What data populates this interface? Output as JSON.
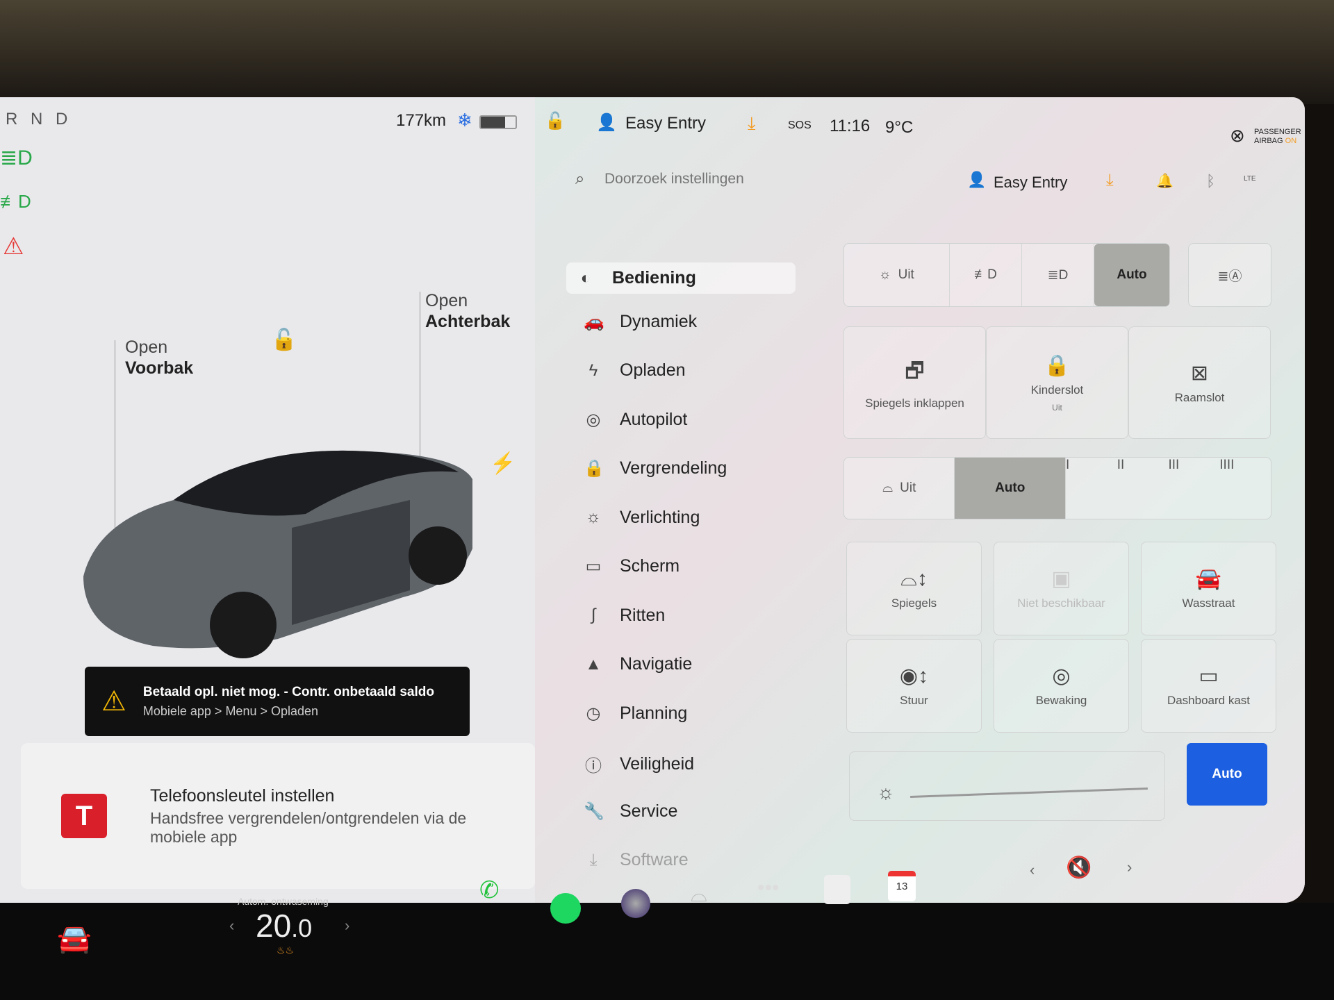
{
  "status_bar": {
    "gear": "R N D",
    "range": "177km",
    "time": "11:16",
    "temperature": "9°C",
    "profile": "Easy Entry",
    "sos": "SOS",
    "airbag_line1": "PASSENGER",
    "airbag_line2": "AIRBAG",
    "airbag_state": "ON"
  },
  "car_view": {
    "frunk_label1": "Open",
    "frunk_label2": "Voorbak",
    "trunk_label1": "Open",
    "trunk_label2": "Achterbak"
  },
  "alert": {
    "title": "Betaald opl. niet mog. - Contr. onbetaald saldo",
    "subtitle": "Mobiele app > Menu > Opladen"
  },
  "phone_key_card": {
    "title": "Telefoonsleutel instellen",
    "description": "Handsfree vergrendelen/ontgrendelen via de mobiele app"
  },
  "settings": {
    "search_placeholder": "Doorzoek instellingen",
    "profile": "Easy Entry",
    "network": "LTE",
    "menu": [
      {
        "label": "Bediening",
        "icon": "toggle-icon"
      },
      {
        "label": "Dynamiek",
        "icon": "car-icon"
      },
      {
        "label": "Opladen",
        "icon": "bolt-icon"
      },
      {
        "label": "Autopilot",
        "icon": "steering-wheel-icon"
      },
      {
        "label": "Vergrendeling",
        "icon": "lock-icon"
      },
      {
        "label": "Verlichting",
        "icon": "light-icon"
      },
      {
        "label": "Scherm",
        "icon": "display-icon"
      },
      {
        "label": "Ritten",
        "icon": "trips-icon"
      },
      {
        "label": "Navigatie",
        "icon": "navigation-icon"
      },
      {
        "label": "Planning",
        "icon": "schedule-icon"
      },
      {
        "label": "Veiligheid",
        "icon": "safety-icon"
      },
      {
        "label": "Service",
        "icon": "wrench-icon"
      },
      {
        "label": "Software",
        "icon": "download-icon"
      }
    ],
    "active_menu": "Bediening",
    "headlights": {
      "off": "Uit",
      "auto": "Auto",
      "selected": "Auto"
    },
    "tiles_row1": [
      {
        "label": "Spiegels inklappen"
      },
      {
        "label": "Kinderslot",
        "sub": "Uit"
      },
      {
        "label": "Raamslot"
      }
    ],
    "wipers": {
      "off": "Uit",
      "auto": "Auto",
      "speeds": [
        "I",
        "II",
        "III",
        "IIII"
      ],
      "selected": "Auto"
    },
    "tiles_grid": [
      {
        "label": "Spiegels"
      },
      {
        "label": "Niet beschikbaar"
      },
      {
        "label": "Wasstraat"
      },
      {
        "label": "Stuur"
      },
      {
        "label": "Bewaking"
      },
      {
        "label": "Dashboard kast"
      }
    ],
    "brightness": {
      "auto_label": "Auto",
      "level": 0.95
    }
  },
  "climate": {
    "label": "Autom. ontwaseming",
    "temp_int": "20",
    "temp_dec": ".0"
  },
  "dock": {
    "calendar_day": "13"
  },
  "colors": {
    "accent": "#1c5fe0",
    "tesla_red": "#d81f2a",
    "alert_bg": "#111111",
    "warning": "#f2b705",
    "spotify": "#1ed760",
    "phone": "#22c33a"
  }
}
